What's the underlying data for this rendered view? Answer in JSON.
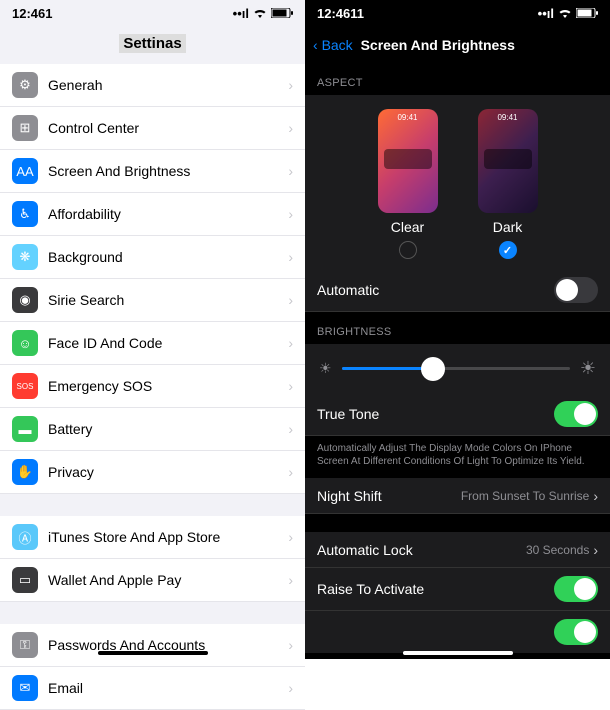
{
  "left": {
    "status": {
      "time": "12:461"
    },
    "title": "Settinas",
    "groups": [
      [
        {
          "icon": "gear-icon",
          "color": "gray",
          "label": "Generah"
        },
        {
          "icon": "control-center-icon",
          "color": "gray",
          "label": "Control Center"
        },
        {
          "icon": "text-size-icon",
          "color": "blue",
          "label": "Screen And Brightness"
        },
        {
          "icon": "accessibility-icon",
          "color": "blue",
          "label": "Affordability"
        },
        {
          "icon": "wallpaper-icon",
          "color": "teal",
          "label": "Background"
        },
        {
          "icon": "siri-icon",
          "color": "darkgray",
          "label": "Sirie Search"
        },
        {
          "icon": "faceid-icon",
          "color": "green",
          "label": "Face ID And Code"
        },
        {
          "icon": "sos-icon",
          "color": "red",
          "label": "Emergency SOS"
        },
        {
          "icon": "battery-icon",
          "color": "green",
          "label": "Battery"
        },
        {
          "icon": "privacy-icon",
          "color": "blue",
          "label": "Privacy"
        }
      ],
      [
        {
          "icon": "appstore-icon",
          "color": "bluelight",
          "label": "iTunes Store And App Store"
        },
        {
          "icon": "wallet-icon",
          "color": "darkgray",
          "label": "Wallet And Apple Pay"
        }
      ],
      [
        {
          "icon": "key-icon",
          "color": "gray",
          "label": "Passwords And Accounts"
        },
        {
          "icon": "mail-icon",
          "color": "blue",
          "label": "Email"
        }
      ]
    ]
  },
  "right": {
    "status": {
      "time": "12:4611"
    },
    "back": "Back",
    "title": "Screen And Brightness",
    "aspect": {
      "header": "ASPECT",
      "options": [
        {
          "label": "Clear",
          "preview_time": "09:41",
          "selected": false
        },
        {
          "label": "Dark",
          "preview_time": "09:41",
          "selected": true
        }
      ],
      "automatic": {
        "label": "Automatic",
        "on": false
      }
    },
    "brightness": {
      "header": "BRIGHTNESS",
      "value": 40,
      "truetone": {
        "label": "True Tone",
        "on": true
      },
      "desc": "Automatically Adjust The Display Mode Colors On IPhone Screen At Different Conditions Of Light To Optimize Its Yield."
    },
    "nightshift": {
      "label": "Night Shift",
      "detail": "From Sunset To Sunrise"
    },
    "autolock": {
      "label": "Automatic Lock",
      "detail": "30 Seconds"
    },
    "raise": {
      "label": "Raise To Activate",
      "on": true
    }
  }
}
